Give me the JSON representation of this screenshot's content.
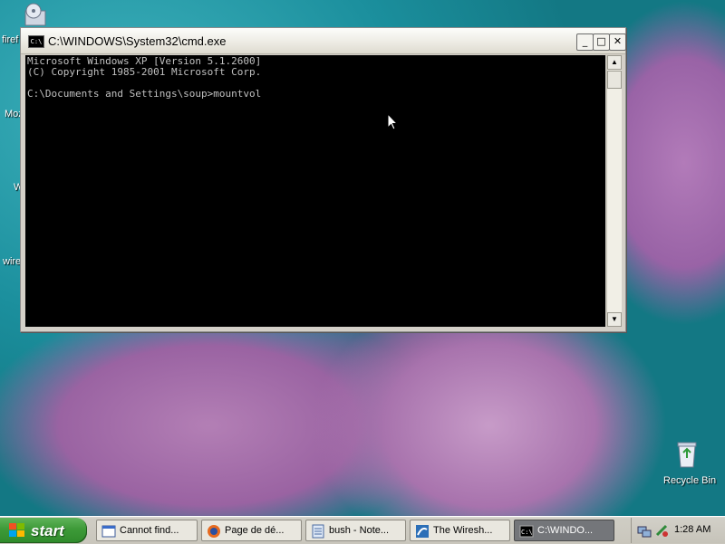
{
  "desktop": {
    "icons": [
      {
        "label": "firef"
      },
      {
        "label": "Moz"
      },
      {
        "label": "W"
      },
      {
        "label": "wire"
      }
    ],
    "recycle_bin_label": "Recycle Bin"
  },
  "cmd_window": {
    "title": "C:\\WINDOWS\\System32\\cmd.exe",
    "minimize_glyph": "_",
    "maximize_glyph": "□",
    "close_glyph": "✕",
    "lines": [
      "Microsoft Windows XP [Version 5.1.2600]",
      "(C) Copyright 1985-2001 Microsoft Corp.",
      "",
      "C:\\Documents and Settings\\soup>mountvol"
    ]
  },
  "taskbar": {
    "start_label": "start",
    "tasks": [
      {
        "label": "Cannot find...",
        "icon": "error-dialog-icon"
      },
      {
        "label": "Page de dé...",
        "icon": "firefox-icon"
      },
      {
        "label": "bush - Note...",
        "icon": "notepad-icon"
      },
      {
        "label": "The Wiresh...",
        "icon": "wireshark-icon"
      },
      {
        "label": "C:\\WINDO...",
        "icon": "cmd-icon",
        "active": true
      }
    ],
    "clock": "1:28 AM"
  }
}
